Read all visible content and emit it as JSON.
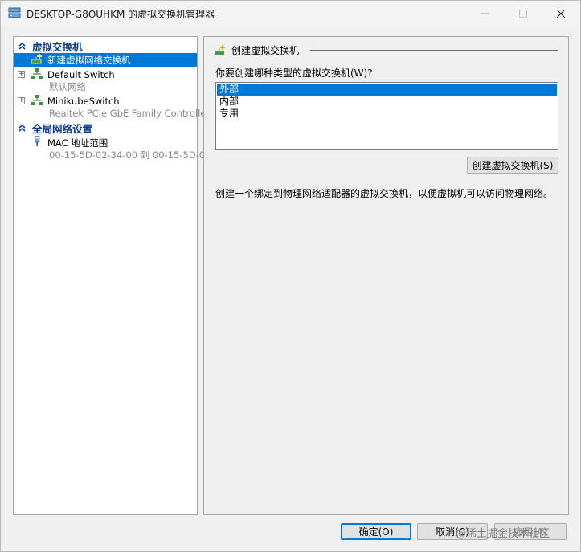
{
  "window": {
    "title": "DESKTOP-G8OUHKM 的虚拟交换机管理器"
  },
  "tree": {
    "section_virtual_switches": "虚拟交换机",
    "new_switch": "新建虚拟网络交换机",
    "default_switch": {
      "name": "Default Switch",
      "sub": "默认网络"
    },
    "minikube_switch": {
      "name": "MinikubeSwitch",
      "sub": "Realtek PCIe GbE Family Controller"
    },
    "section_global": "全局网络设置",
    "mac_range": {
      "name": "MAC 地址范围",
      "sub": "00-15-5D-02-34-00 到 00-15-5D-0..."
    }
  },
  "right": {
    "header": "创建虚拟交换机",
    "question": "你要创建哪种类型的虚拟交换机(W)?",
    "options": [
      "外部",
      "内部",
      "专用"
    ],
    "selected_option": "外部",
    "create_button": "创建虚拟交换机(S)",
    "description": "创建一个绑定到物理网络适配器的虚拟交换机，以便虚拟机可以访问物理网络。"
  },
  "footer": {
    "ok": "确定(O)",
    "cancel": "取消(C)",
    "apply": "应用(A)",
    "watermark": "@稀土掘金技术社区"
  },
  "colors": {
    "selection": "#0078d7",
    "section_header": "#0b3a8a",
    "switch_icon": "#2f7d32"
  }
}
